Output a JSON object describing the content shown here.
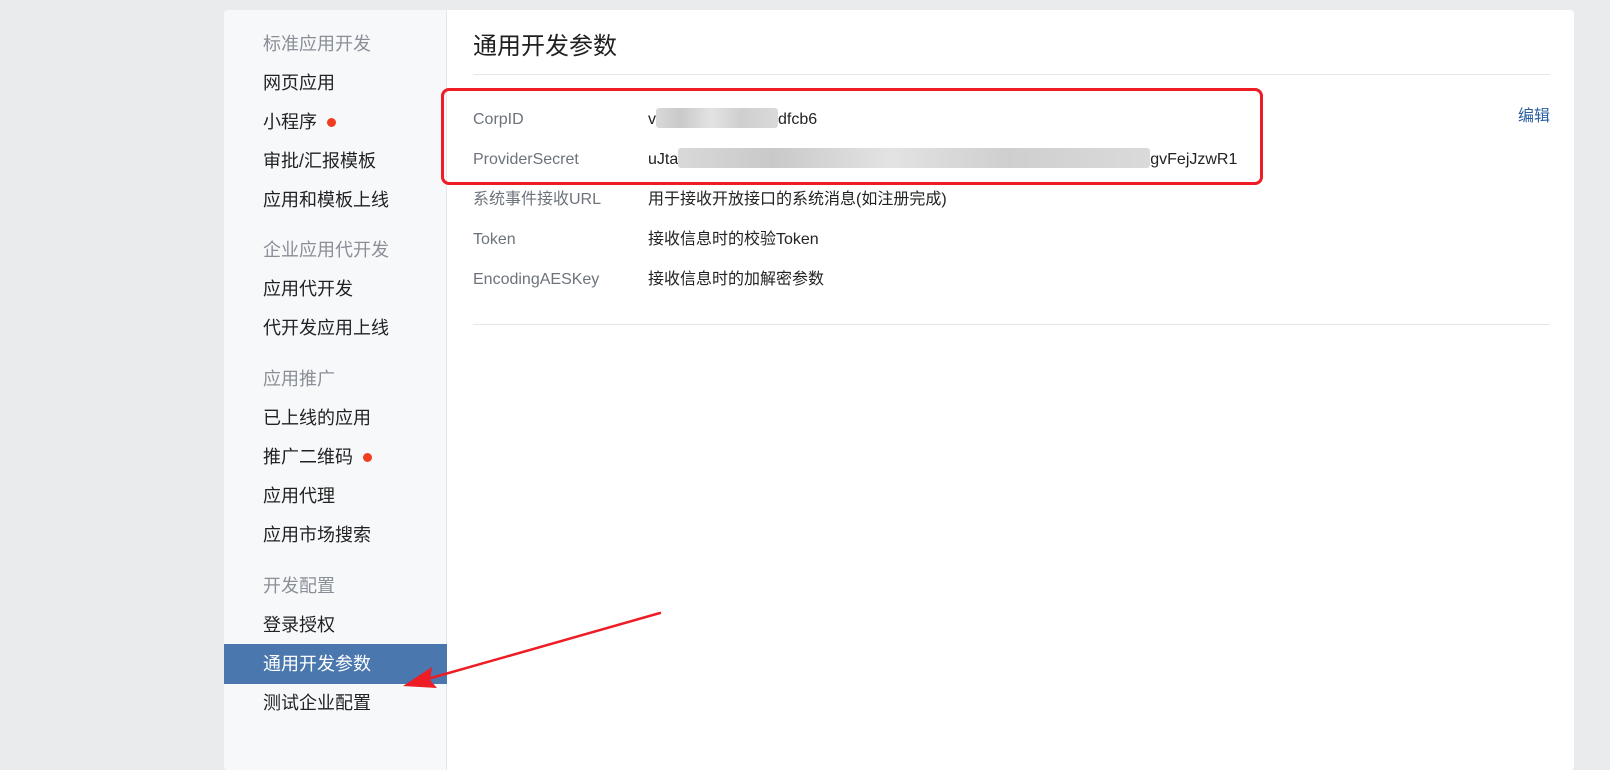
{
  "sidebar": {
    "groups": [
      {
        "title": "标准应用开发",
        "items": [
          {
            "label": "网页应用"
          },
          {
            "label": "小程序"
          },
          {
            "label": "审批/汇报模板"
          },
          {
            "label": "应用和模板上线"
          }
        ]
      },
      {
        "title": "企业应用代开发",
        "items": [
          {
            "label": "应用代开发"
          },
          {
            "label": "代开发应用上线"
          }
        ]
      },
      {
        "title": "应用推广",
        "items": [
          {
            "label": "已上线的应用"
          },
          {
            "label": "推广二维码"
          },
          {
            "label": "应用代理"
          },
          {
            "label": "应用市场搜索"
          }
        ]
      },
      {
        "title": "开发配置",
        "items": [
          {
            "label": "登录授权"
          },
          {
            "label": "通用开发参数"
          },
          {
            "label": "测试企业配置"
          }
        ]
      }
    ]
  },
  "main": {
    "title": "通用开发参数",
    "edit_label": "编辑",
    "params": [
      {
        "label": "CorpID",
        "value_prefix": "v",
        "value_suffix": "dfcb6"
      },
      {
        "label": "ProviderSecret",
        "value_prefix": "uJta",
        "value_suffix": "gvFejJzwR1"
      },
      {
        "label": "系统事件接收URL",
        "value": "用于接收开放接口的系统消息(如注册完成)"
      },
      {
        "label": "Token",
        "value": "接收信息时的校验Token"
      },
      {
        "label": "EncodingAESKey",
        "value": "接收信息时的加解密参数"
      }
    ]
  },
  "colors": {
    "accent": "#4a77ad",
    "badge": "#f23d1f",
    "annotation": "#ee1c25",
    "link": "#2b5fa0"
  }
}
